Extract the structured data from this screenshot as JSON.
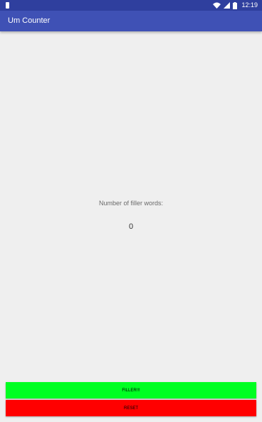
{
  "status_bar": {
    "time": "12:19",
    "icons": [
      "notification-icon",
      "wifi-icon",
      "signal-icon",
      "battery-icon"
    ]
  },
  "app_bar": {
    "title": "Um Counter",
    "color": "#3f51b5"
  },
  "main": {
    "label": "Number of filler words:",
    "count": "0"
  },
  "buttons": {
    "filler_label": "FILLER!!!",
    "filler_color": "#00ff22",
    "reset_label": "RESET",
    "reset_color": "#ff0000"
  }
}
